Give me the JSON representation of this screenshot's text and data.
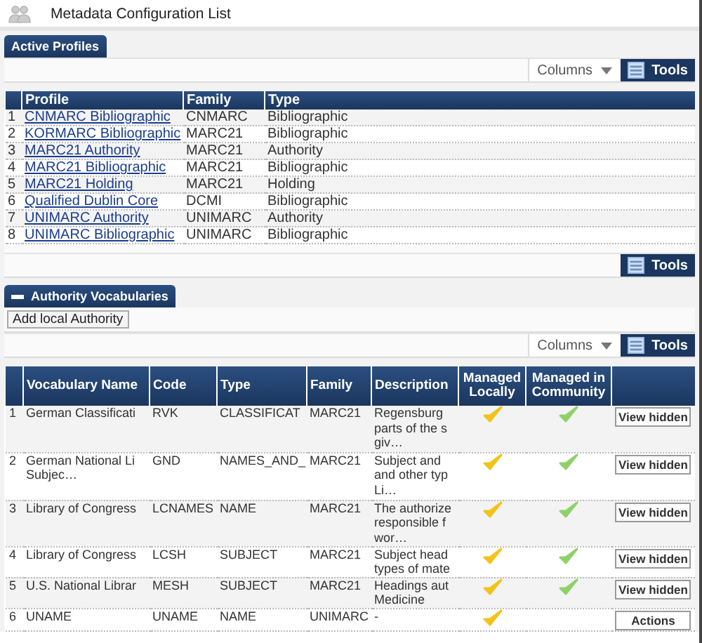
{
  "header": {
    "title": "Metadata Configuration List"
  },
  "active_profiles": {
    "tab": "Active Profiles",
    "columns_menu": "Columns",
    "tools_button": "Tools",
    "bottom_tools_button": "Tools",
    "columns": [
      "Profile",
      "Family",
      "Type"
    ],
    "rows": [
      {
        "index": "1",
        "profile": "CNMARC Bibliographic",
        "family": "CNMARC",
        "type": "Bibliographic"
      },
      {
        "index": "2",
        "profile": "KORMARC Bibliographic",
        "family": "MARC21",
        "type": "Bibliographic"
      },
      {
        "index": "3",
        "profile": "MARC21 Authority",
        "family": "MARC21",
        "type": "Authority"
      },
      {
        "index": "4",
        "profile": "MARC21 Bibliographic",
        "family": "MARC21",
        "type": "Bibliographic"
      },
      {
        "index": "5",
        "profile": "MARC21 Holding",
        "family": "MARC21",
        "type": "Holding"
      },
      {
        "index": "6",
        "profile": "Qualified Dublin Core",
        "family": "DCMI",
        "type": "Bibliographic"
      },
      {
        "index": "7",
        "profile": "UNIMARC Authority",
        "family": "UNIMARC",
        "type": "Authority"
      },
      {
        "index": "8",
        "profile": "UNIMARC Bibliographic",
        "family": "UNIMARC",
        "type": "Bibliographic"
      }
    ]
  },
  "authority_vocabularies": {
    "tab": "Authority Vocabularies",
    "expanded": true,
    "add_button": "Add local Authority",
    "columns_menu": "Columns",
    "tools_button": "Tools",
    "columns": [
      "Vocabulary Name",
      "Code",
      "Type",
      "Family",
      "Description",
      "Managed Locally",
      "Managed in Community"
    ],
    "rows": [
      {
        "index": "1",
        "name": "German Classificati",
        "code": "RVK",
        "type": "CLASSIFICAT",
        "family": "MARC21",
        "description": "Regensburg\nparts of the s\ngiv…",
        "managed_locally": true,
        "managed_in_community": true,
        "action": "View hidden"
      },
      {
        "index": "2",
        "name": "German National Li\nSubjec…",
        "code": "GND",
        "type": "NAMES_AND_",
        "family": "MARC21",
        "description": "Subject and\nand other typ\nLi…",
        "managed_locally": true,
        "managed_in_community": true,
        "action": "View hidden"
      },
      {
        "index": "3",
        "name": "Library of Congress",
        "code": "LCNAMES",
        "type": "NAME",
        "family": "MARC21",
        "description": "The authorize\nresponsible f\nwor…",
        "managed_locally": true,
        "managed_in_community": true,
        "action": "View hidden"
      },
      {
        "index": "4",
        "name": "Library of Congress",
        "code": "LCSH",
        "type": "SUBJECT",
        "family": "MARC21",
        "description": "Subject head\ntypes of mate",
        "managed_locally": true,
        "managed_in_community": true,
        "action": "View hidden"
      },
      {
        "index": "5",
        "name": "U.S. National Librar",
        "code": "MESH",
        "type": "SUBJECT",
        "family": "MARC21",
        "description": "Headings aut\nMedicine",
        "managed_locally": true,
        "managed_in_community": true,
        "action": "View hidden"
      },
      {
        "index": "6",
        "name": "UNAME",
        "code": "UNAME",
        "type": "NAME",
        "family": "UNIMARC",
        "description": "-",
        "managed_locally": true,
        "managed_in_community": false,
        "action": "Actions"
      }
    ]
  }
}
